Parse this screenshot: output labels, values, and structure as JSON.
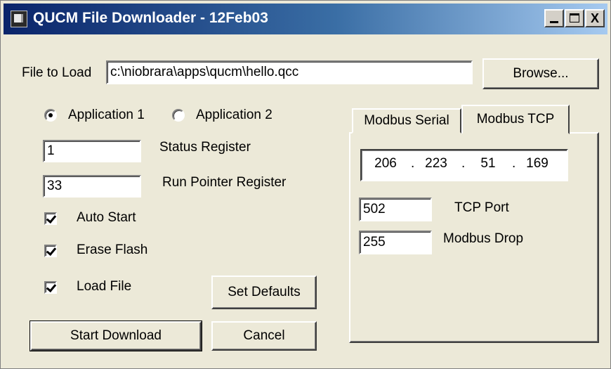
{
  "window": {
    "title": "QUCM File Downloader - 12Feb03",
    "controls": {
      "minimize": "_",
      "maximize": "□",
      "close": "X"
    }
  },
  "file": {
    "label": "File to Load",
    "value": "c:\\niobrara\\apps\\qucm\\hello.qcc",
    "browse_label": "Browse..."
  },
  "application": {
    "options": [
      {
        "label": "Application 1",
        "selected": true
      },
      {
        "label": "Application 2",
        "selected": false
      }
    ]
  },
  "registers": {
    "status": {
      "value": "1",
      "label": "Status Register"
    },
    "run_pointer": {
      "value": "33",
      "label": "Run Pointer Register"
    }
  },
  "options": {
    "auto_start": {
      "label": "Auto Start",
      "checked": true
    },
    "erase_flash": {
      "label": "Erase Flash",
      "checked": true
    },
    "load_file": {
      "label": "Load File",
      "checked": true
    }
  },
  "buttons": {
    "set_defaults": "Set Defaults",
    "start_download": "Start Download",
    "cancel": "Cancel"
  },
  "tabs": {
    "items": [
      {
        "label": "Modbus Serial",
        "active": false
      },
      {
        "label": "Modbus TCP",
        "active": true
      }
    ]
  },
  "tcp": {
    "ip": [
      "206",
      "223",
      "51",
      "169"
    ],
    "ip_separator": ".",
    "port": {
      "value": "502",
      "label": "TCP Port"
    },
    "drop": {
      "value": "255",
      "label": "Modbus Drop"
    }
  }
}
